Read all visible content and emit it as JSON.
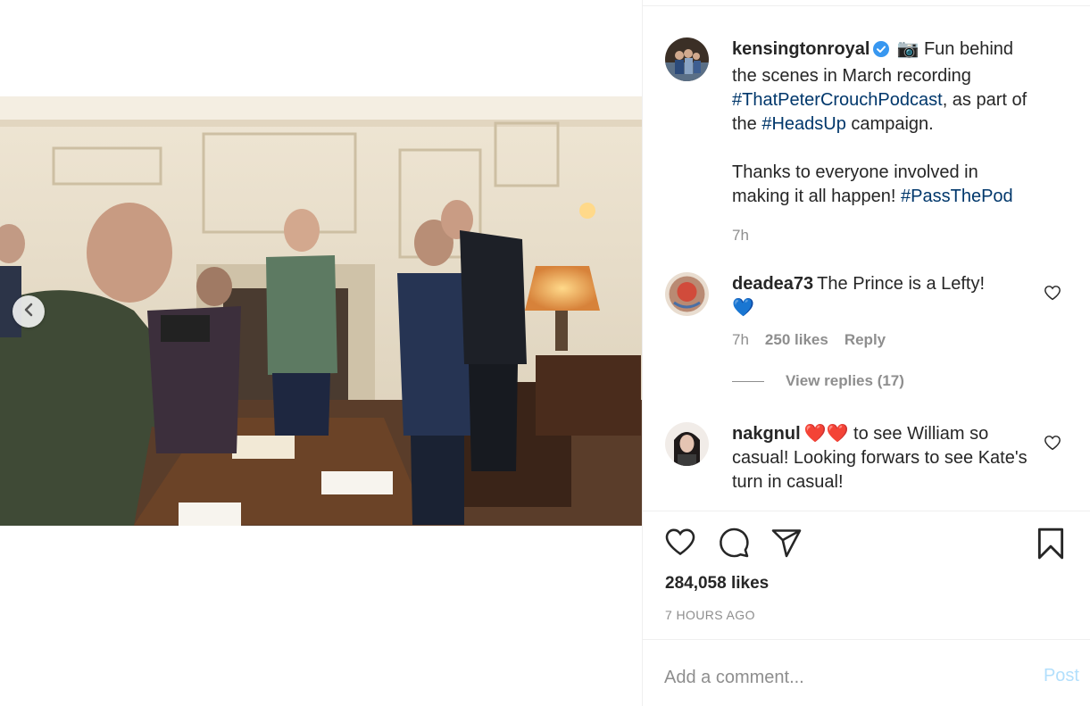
{
  "post": {
    "username": "kensingtonroyal",
    "caption_emoji": "📷",
    "caption_part1": " Fun behind the scenes in March recording ",
    "hashtag1": "#ThatPeterCrouchPodcast",
    "caption_part2": ", as part of the ",
    "hashtag2": "#HeadsUp",
    "caption_part3": " campaign.",
    "caption_line2": "Thanks to everyone involved in making it all happen! ",
    "hashtag3": "#PassThePod",
    "time": "7h"
  },
  "comments": [
    {
      "username": "deadea73",
      "text": "The Prince is a Lefty!",
      "emoji": "💙",
      "time": "7h",
      "likes": "250 likes",
      "reply_label": "Reply",
      "view_replies": "View replies (17)"
    },
    {
      "username": "nakgnul",
      "emoji": "❤️❤️",
      "text": " to see William so casual! Looking forwars to see Kate's turn in casual!"
    }
  ],
  "stats": {
    "likes": "284,058 likes",
    "time_ago": "7 HOURS AGO"
  },
  "composer": {
    "placeholder": "Add a comment...",
    "post_label": "Post"
  },
  "colors": {
    "hashtag": "#00376b",
    "verified": "#3897f0",
    "post_disabled": "#b2dffc",
    "muted": "#8e8e8e"
  },
  "icons": [
    "chevron-left-icon",
    "verified-badge-icon",
    "heart-icon",
    "comment-icon",
    "share-icon",
    "bookmark-icon"
  ]
}
